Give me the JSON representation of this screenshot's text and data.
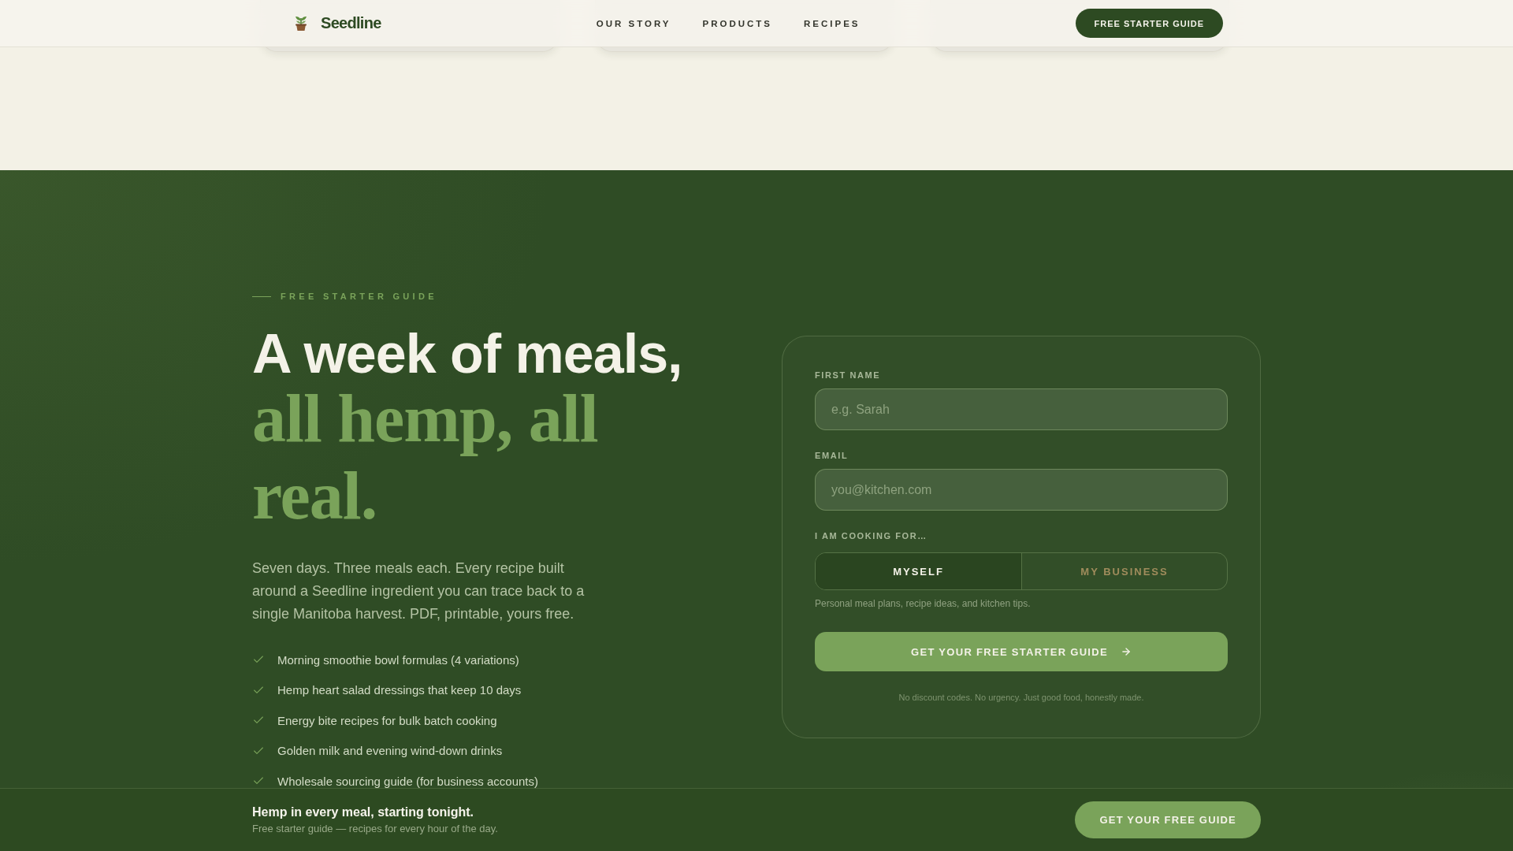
{
  "header": {
    "brand": "Seedline",
    "nav": [
      {
        "label": "OUR STORY"
      },
      {
        "label": "PRODUCTS"
      },
      {
        "label": "RECIPES"
      }
    ],
    "cta": "FREE STARTER GUIDE"
  },
  "hero": {
    "eyebrow": "FREE STARTER GUIDE",
    "title": "A week of meals,",
    "title_accent": "all hemp, all real.",
    "intro": "Seven days. Three meals each. Every recipe built around a Seedline ingredient you can trace back to a single Manitoba harvest. PDF, printable, yours free.",
    "benefits": [
      "Morning smoothie bowl formulas (4 variations)",
      "Hemp heart salad dressings that keep 10 days",
      "Energy bite recipes for bulk batch cooking",
      "Golden milk and evening wind-down drinks",
      "Wholesale sourcing guide (for business accounts)"
    ]
  },
  "form": {
    "fields": [
      {
        "label": "FIRST NAME",
        "placeholder": "e.g. Sarah"
      },
      {
        "label": "EMAIL",
        "placeholder": "you@kitchen.com"
      }
    ],
    "audience": {
      "label": "I AM COOKING FOR…",
      "options": [
        {
          "label": "MYSELF",
          "selected": true
        },
        {
          "label": "MY BUSINESS",
          "selected": false
        }
      ],
      "hint": "Personal meal plans, recipe ideas, and kitchen tips."
    },
    "submit": "GET YOUR FREE STARTER GUIDE",
    "note": "No discount codes. No urgency. Just good food, honestly made."
  },
  "sticky_bar": {
    "title": "Hemp in every meal, starting tonight.",
    "subtitle": "Free starter guide — recipes for every hour of the day.",
    "button": "GET YOUR FREE GUIDE"
  }
}
